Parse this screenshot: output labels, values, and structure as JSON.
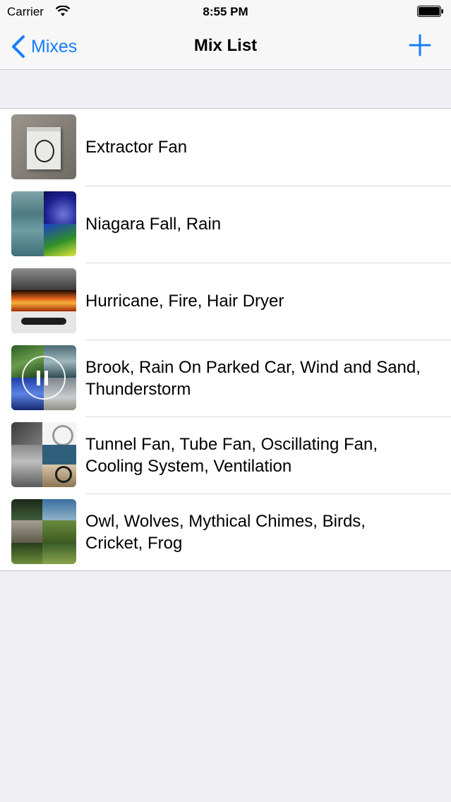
{
  "status_bar": {
    "carrier": "Carrier",
    "time": "8:55 PM"
  },
  "nav": {
    "back_label": "Mixes",
    "title": "Mix List",
    "add_icon": "plus-icon",
    "accent_color": "#157efb"
  },
  "mixes": [
    {
      "label": "Extractor Fan"
    },
    {
      "label": "Niagara Fall, Rain"
    },
    {
      "label": "Hurricane, Fire, Hair Dryer"
    },
    {
      "label": "Brook, Rain On Parked Car, Wind and Sand, Thunderstorm",
      "playing": true,
      "overlay_icon": "pause-icon"
    },
    {
      "label": "Tunnel Fan, Tube Fan, Oscillating Fan, Cooling System, Ventilation"
    },
    {
      "label": "Owl, Wolves, Mythical Chimes, Birds, Cricket, Frog"
    }
  ]
}
